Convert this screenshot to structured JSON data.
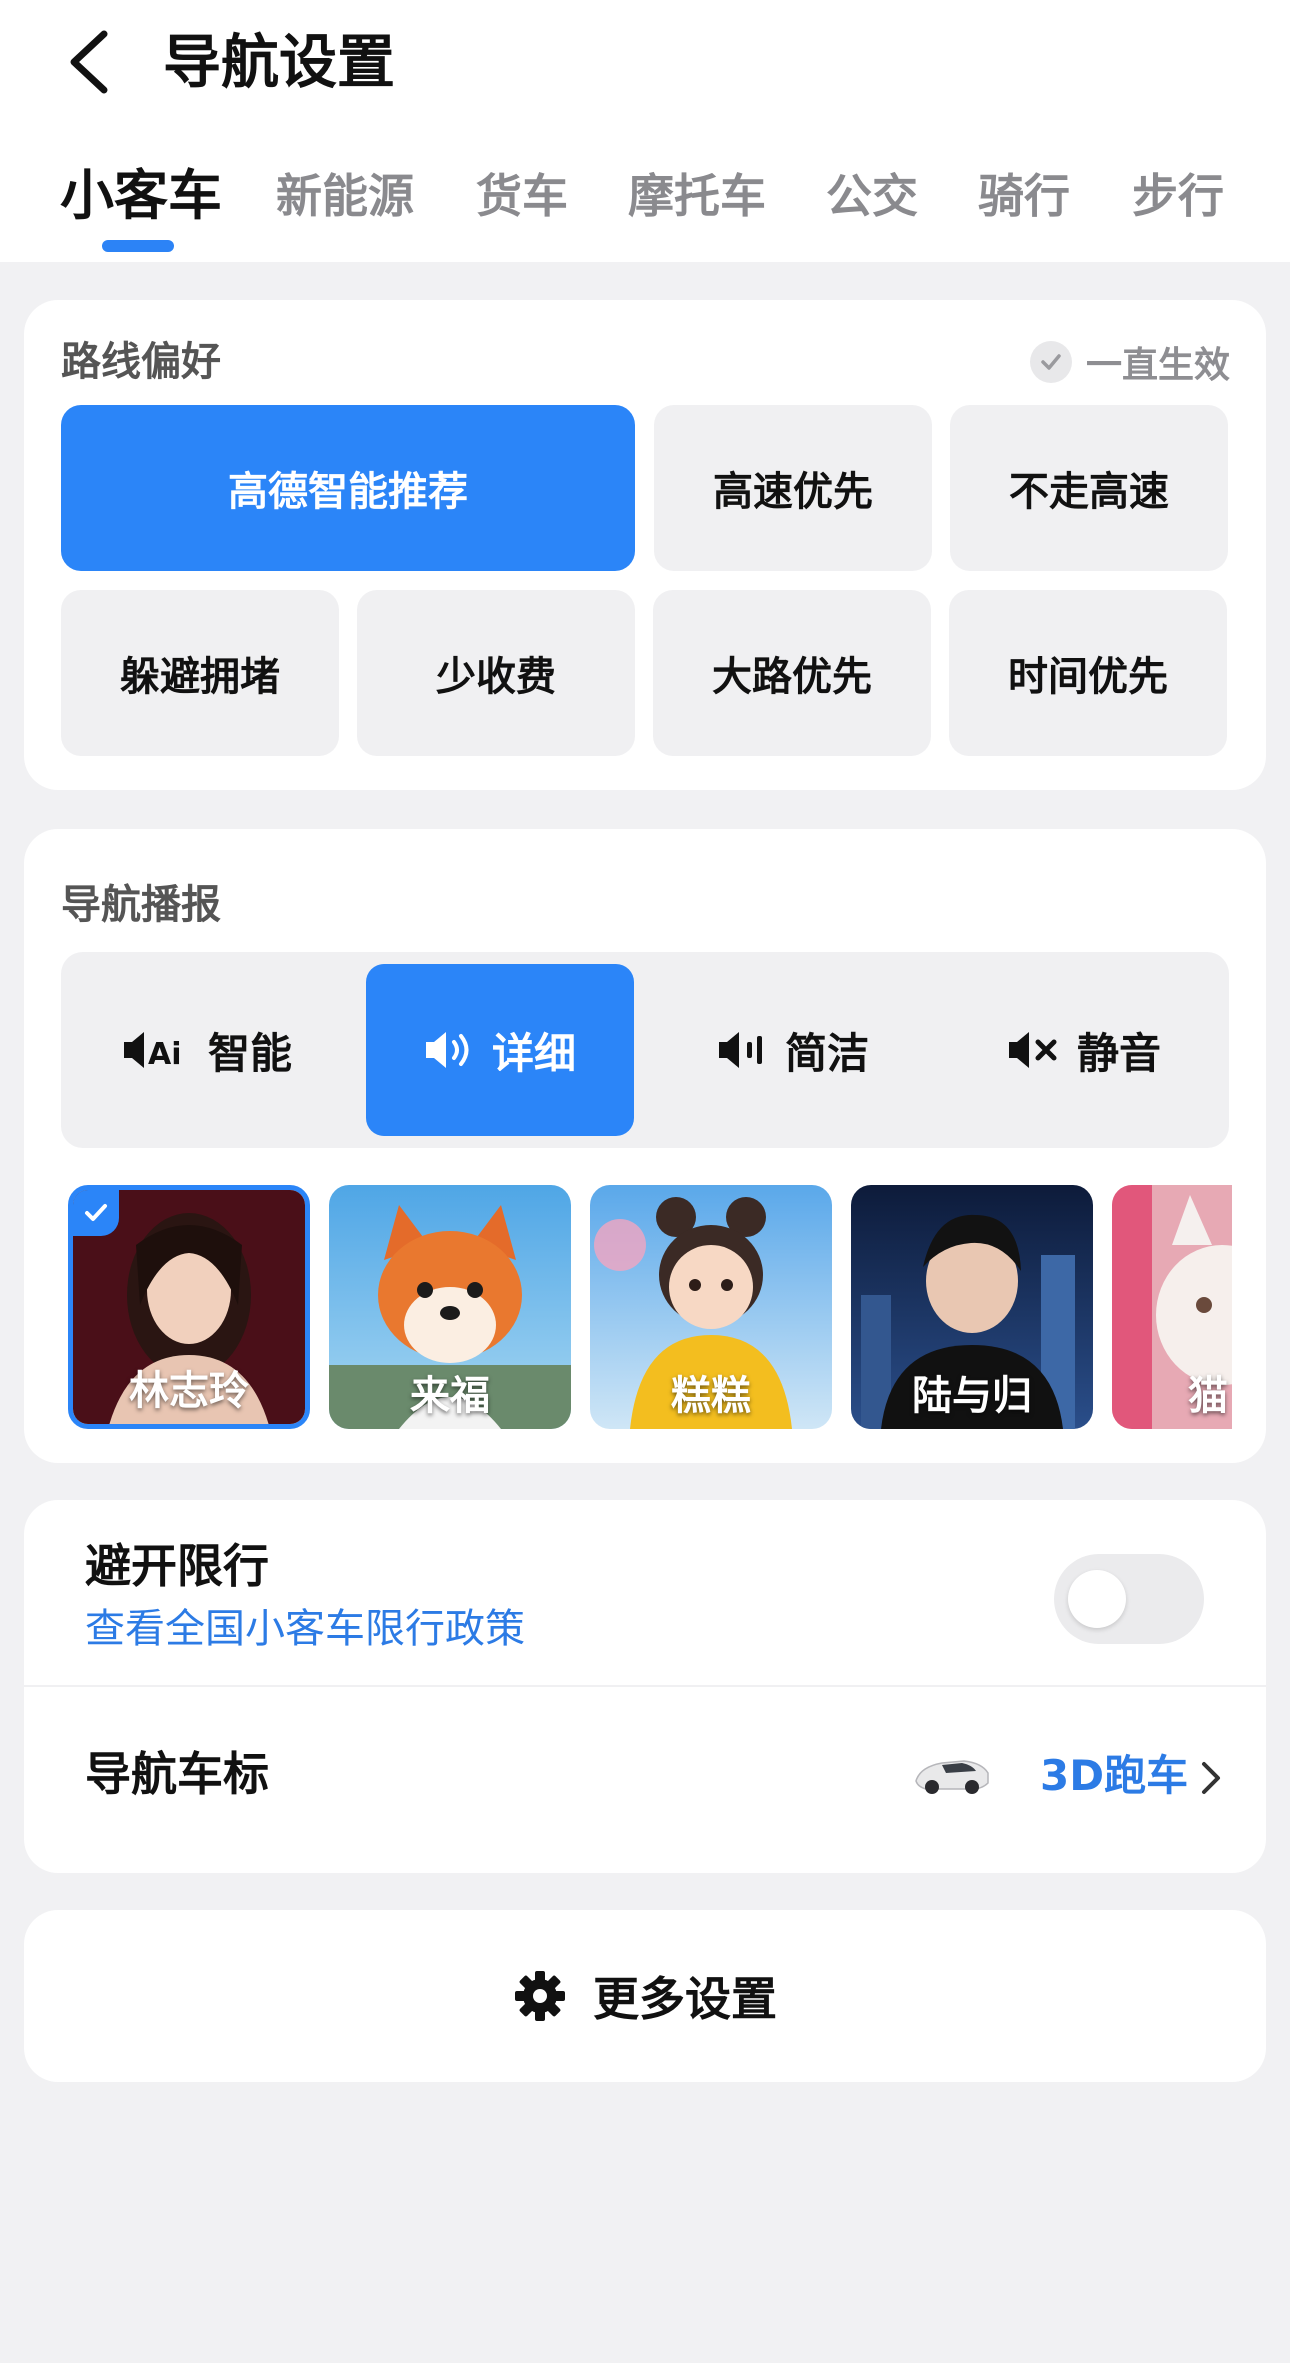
{
  "header": {
    "title": "导航设置"
  },
  "tabs": [
    {
      "label": "小客车",
      "active": true
    },
    {
      "label": "新能源"
    },
    {
      "label": "货车"
    },
    {
      "label": "摩托车"
    },
    {
      "label": "公交"
    },
    {
      "label": "骑行"
    },
    {
      "label": "步行"
    }
  ],
  "route": {
    "label": "路线偏好",
    "always_label": "一直生效",
    "options": [
      {
        "label": "高德智能推荐",
        "selected": true
      },
      {
        "label": "高速优先"
      },
      {
        "label": "不走高速"
      },
      {
        "label": "躲避拥堵"
      },
      {
        "label": "少收费"
      },
      {
        "label": "大路优先"
      },
      {
        "label": "时间优先"
      }
    ]
  },
  "voice": {
    "label": "导航播报",
    "modes": [
      {
        "label": "智能",
        "icon": "speaker-ai-icon"
      },
      {
        "label": "详细",
        "icon": "speaker-wave-icon",
        "selected": true
      },
      {
        "label": "简洁",
        "icon": "speaker-bar-icon"
      },
      {
        "label": "静音",
        "icon": "speaker-mute-icon"
      }
    ],
    "voices": [
      {
        "name": "林志玲",
        "selected": true
      },
      {
        "name": "来福"
      },
      {
        "name": "糕糕"
      },
      {
        "name": "陆与归"
      },
      {
        "name": "猫"
      }
    ]
  },
  "restriction": {
    "title": "避开限行",
    "link": "查看全国小客车限行政策",
    "enabled": false
  },
  "car_icon": {
    "title": "导航车标",
    "value": "3D跑车"
  },
  "more": {
    "label": "更多设置"
  },
  "colors": {
    "accent": "#2b85f8",
    "link": "#2c7be5",
    "background": "#f1f1f3"
  }
}
